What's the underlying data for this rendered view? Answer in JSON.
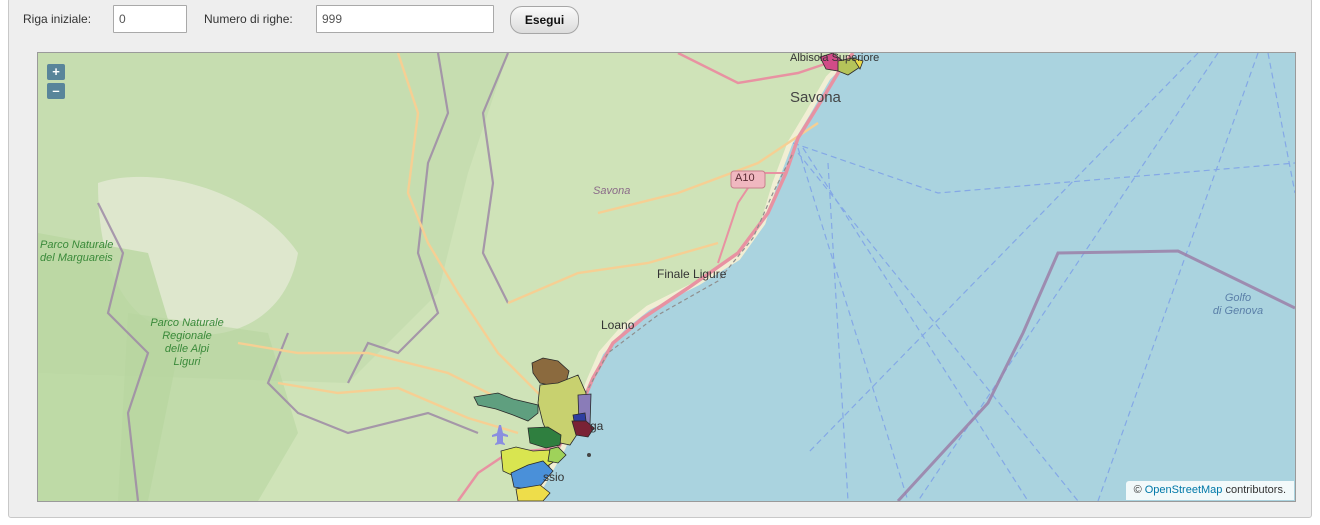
{
  "controls": {
    "start_row_label": "Riga iniziale:",
    "start_row_value": "0",
    "num_rows_label": "Numero di righe:",
    "num_rows_value": "999",
    "run_button": "Esegui"
  },
  "map": {
    "zoom_in": "+",
    "zoom_out": "–",
    "labels": {
      "albisola": "Albisola Superiore",
      "savona_city": "Savona",
      "highway": "A10",
      "savona_province": "Savona",
      "parco_marguareis_1": "Parco Naturale",
      "parco_marguareis_2": "del Marguareis",
      "parco_alpi_1": "Parco Naturale",
      "parco_alpi_2": "Regionale",
      "parco_alpi_3": "delle Alpi",
      "parco_alpi_4": "Liguri",
      "finale": "Finale Ligure",
      "loano": "Loano",
      "golfo_1": "Golfo",
      "golfo_2": "di Genova",
      "albenga_partial": "ga",
      "alassio_partial": "ssio"
    },
    "attribution_prefix": "©",
    "attribution_link": "OpenStreetMap",
    "attribution_suffix": "contributors.",
    "colors": {
      "sea": "#aad3df",
      "land": "#cfe3b8",
      "motorway": "#e892a2",
      "primary": "#f4c28a",
      "border": "#9e7ea6"
    }
  }
}
